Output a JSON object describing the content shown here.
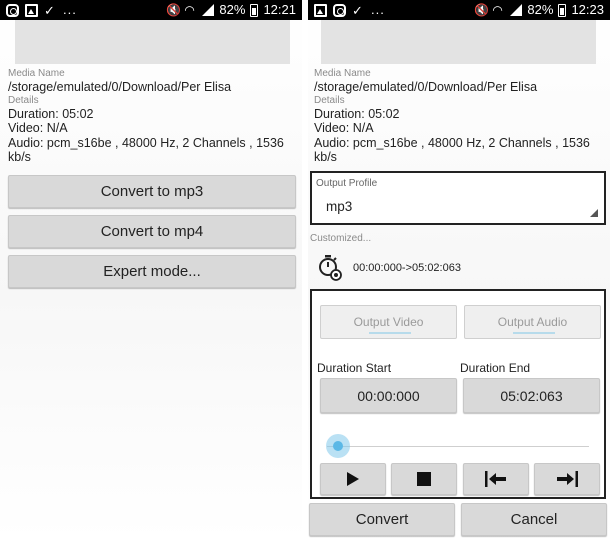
{
  "left_screen": {
    "status_bar": {
      "battery": "82%",
      "time": "12:21",
      "overflow": "..."
    },
    "media_name_label": "Media Name",
    "media_path": "/storage/emulated/0/Download/Per Elisa",
    "details_label": "Details",
    "duration": "Duration: 05:02",
    "video": "Video: N/A",
    "audio": "Audio: pcm_s16be , 48000 Hz, 2 Channels , 1536 kb/s",
    "buttons": [
      "Convert to mp3",
      "Convert to mp4",
      "Expert mode..."
    ]
  },
  "right_screen": {
    "status_bar": {
      "battery": "82%",
      "time": "12:23",
      "overflow": "..."
    },
    "media_name_label": "Media Name",
    "media_path": "/storage/emulated/0/Download/Per Elisa",
    "details_label": "Details",
    "duration": "Duration: 05:02",
    "video": "Video: N/A",
    "audio": "Audio: pcm_s16be , 48000 Hz, 2 Channels , 1536 kb/s",
    "output_profile_label": "Output Profile",
    "output_profile_value": "mp3",
    "customized_label": "Customized...",
    "time_range": "00:00:000->05:02:063",
    "tabs": {
      "output_video": "Output Video",
      "output_audio": "Output Audio"
    },
    "duration_start_label": "Duration Start",
    "duration_end_label": "Duration End",
    "duration_start_value": "00:00:000",
    "duration_end_value": "05:02:063",
    "slider_position": 0,
    "convert_label": "Convert",
    "cancel_label": "Cancel"
  },
  "icons": [
    "instagram-icon",
    "gallery-icon",
    "check-icon",
    "mute-icon",
    "wifi-icon",
    "signal-icon",
    "battery-icon",
    "timer-icon",
    "play-icon",
    "stop-icon",
    "set-start-icon",
    "set-end-icon",
    "dropdown-arrow-icon"
  ],
  "colors": {
    "status_bar": "#000000",
    "button": "#d9d9d9",
    "accent": "#5bb8e6",
    "banner": "#e3e3e3"
  }
}
